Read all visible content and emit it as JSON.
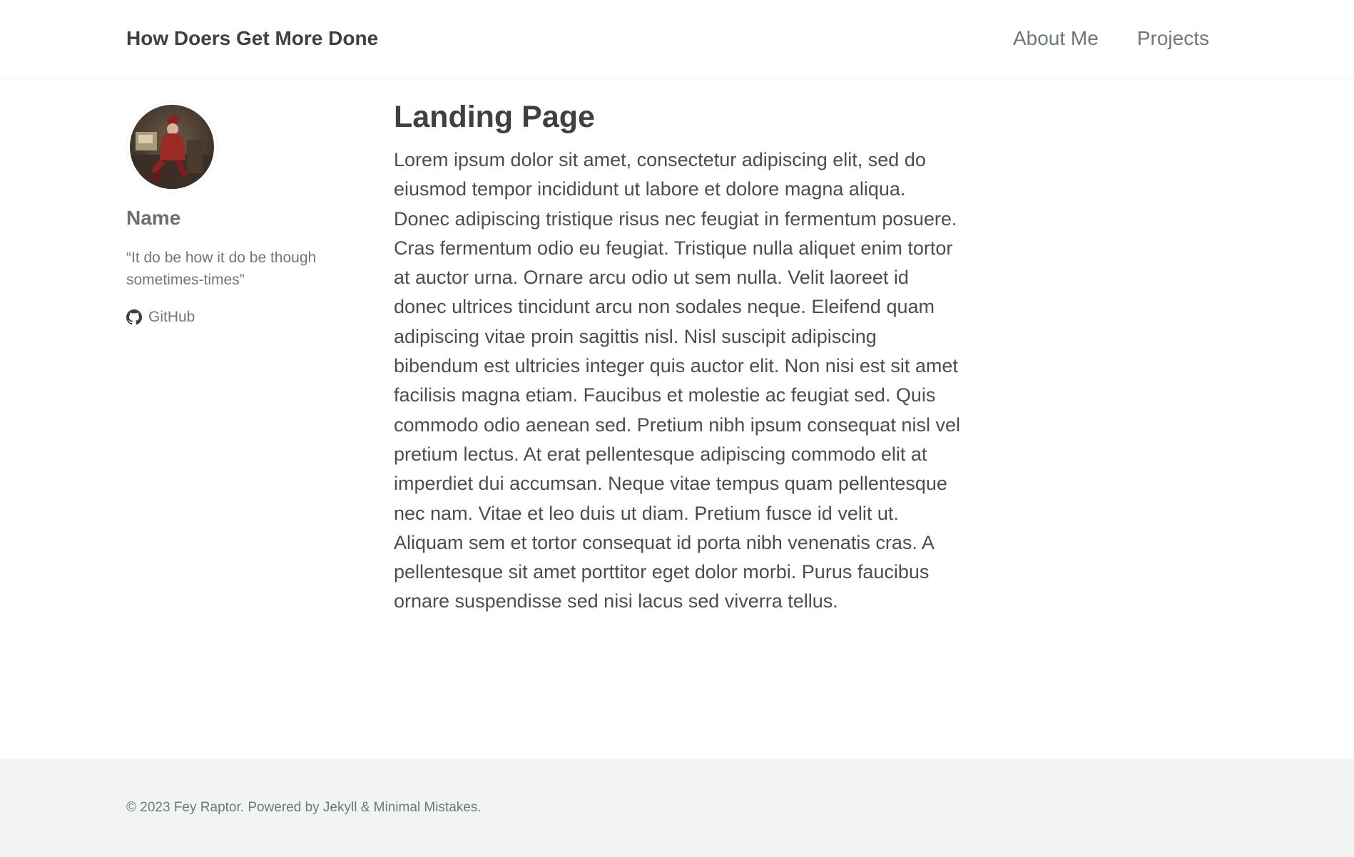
{
  "header": {
    "site_title": "How Doers Get More Done",
    "nav": [
      {
        "label": "About Me"
      },
      {
        "label": "Projects"
      }
    ]
  },
  "sidebar": {
    "avatar_icon": "jester-portrait-avatar",
    "author_name": "Name",
    "bio": "“It do be how it do be though sometimes-times”",
    "links": [
      {
        "icon": "github-icon",
        "label": "GitHub"
      }
    ]
  },
  "main": {
    "title": "Landing Page",
    "body": "Lorem ipsum dolor sit amet, consectetur adipiscing elit, sed do eiusmod tempor incididunt ut labore et dolore magna aliqua. Donec adipiscing tristique risus nec feugiat in fermentum posuere. Cras fermentum odio eu feugiat. Tristique nulla aliquet enim tortor at auctor urna. Ornare arcu odio ut sem nulla. Velit laoreet id donec ultrices tincidunt arcu non sodales neque. Eleifend quam adipiscing vitae proin sagittis nisl. Nisl suscipit adipiscing bibendum est ultricies integer quis auctor elit. Non nisi est sit amet facilisis magna etiam. Faucibus et molestie ac feugiat sed. Quis commodo odio aenean sed. Pretium nibh ipsum consequat nisl vel pretium lectus. At erat pellentesque adipiscing commodo elit at imperdiet dui accumsan. Neque vitae tempus quam pellentesque nec nam. Vitae et leo duis ut diam. Pretium fusce id velit ut. Aliquam sem et tortor consequat id porta nibh venenatis cras. A pellentesque sit amet porttitor eget dolor morbi. Purus faucibus ornare suspendisse sed nisi lacus sed viverra tellus."
  },
  "footer": {
    "copyright": "© 2023 Fey Raptor. Powered by Jekyll & Minimal Mistakes."
  },
  "colors": {
    "text": "#494e52",
    "muted": "#6f777d",
    "footer_bg": "#f2f3f3"
  }
}
